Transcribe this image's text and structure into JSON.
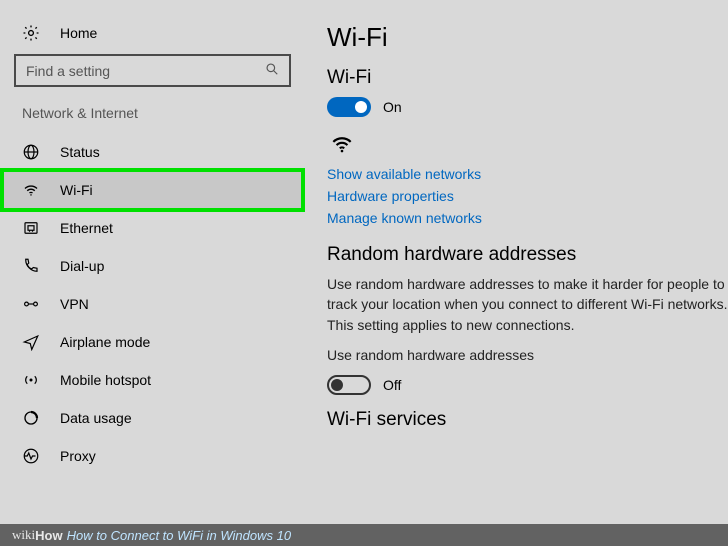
{
  "sidebar": {
    "home_label": "Home",
    "search_placeholder": "Find a setting",
    "section_label": "Network & Internet",
    "items": [
      {
        "label": "Status"
      },
      {
        "label": "Wi-Fi"
      },
      {
        "label": "Ethernet"
      },
      {
        "label": "Dial-up"
      },
      {
        "label": "VPN"
      },
      {
        "label": "Airplane mode"
      },
      {
        "label": "Mobile hotspot"
      },
      {
        "label": "Data usage"
      },
      {
        "label": "Proxy"
      }
    ]
  },
  "main": {
    "page_title": "Wi-Fi",
    "wifi_toggle": {
      "label": "Wi-Fi",
      "state": "On"
    },
    "links": {
      "show_networks": "Show available networks",
      "hardware_props": "Hardware properties",
      "manage_known": "Manage known networks"
    },
    "random_hw": {
      "heading": "Random hardware addresses",
      "description": "Use random hardware addresses to make it harder for people to track your location when you connect to different Wi-Fi networks. This setting applies to new connections.",
      "toggle_label": "Use random hardware addresses",
      "toggle_state": "Off"
    },
    "wifi_services_heading": "Wi-Fi services"
  },
  "caption": {
    "prefix_wiki": "wiki",
    "prefix_how": "How",
    "title": "How to Connect to WiFi in Windows 10"
  }
}
